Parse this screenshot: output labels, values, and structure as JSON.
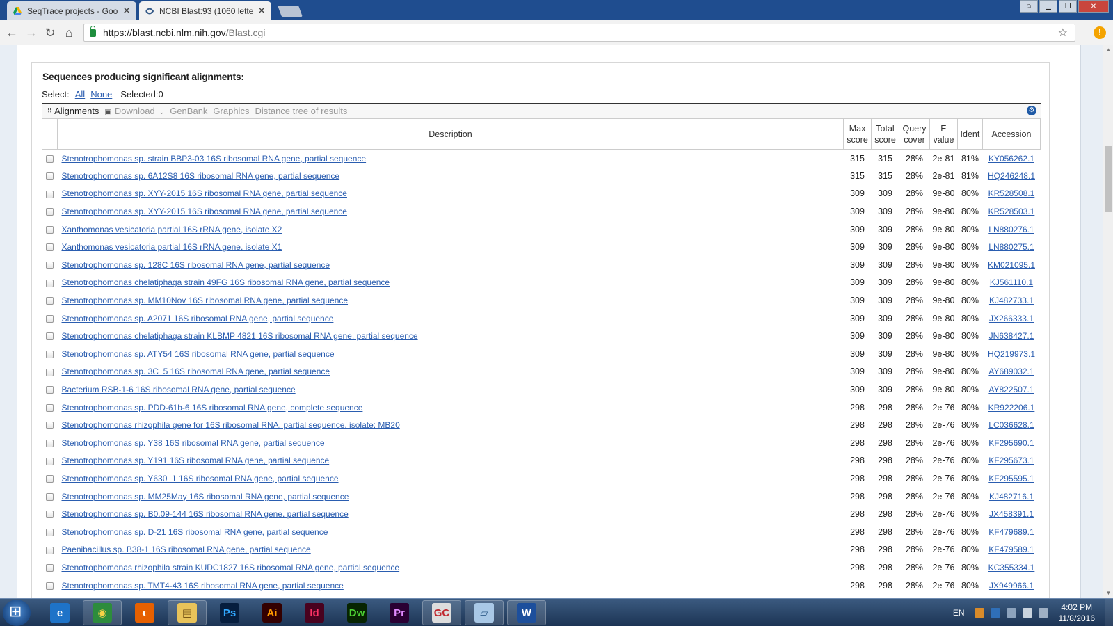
{
  "browser": {
    "tabs": [
      {
        "title": "SeqTrace projects - Goo",
        "active": false
      },
      {
        "title": "NCBI Blast:93 (1060 lette",
        "active": true
      }
    ],
    "url_main": "https://blast.ncbi.nlm.nih.gov",
    "url_path": "/Blast.cgi"
  },
  "results": {
    "section_title": "Sequences producing significant alignments:",
    "select_label": "Select:",
    "select_all": "All",
    "select_none": "None",
    "selected_text": "Selected:0",
    "toolbar": {
      "alignments": "Alignments",
      "download": "Download",
      "genbank": "GenBank",
      "graphics": "Graphics",
      "distance_tree": "Distance tree of results"
    },
    "columns": {
      "description": "Description",
      "max_score": [
        "Max",
        "score"
      ],
      "total_score": [
        "Total",
        "score"
      ],
      "query_cover": [
        "Query",
        "cover"
      ],
      "e_value": [
        "E",
        "value"
      ],
      "ident": "Ident",
      "accession": "Accession"
    },
    "rows": [
      {
        "desc": "Stenotrophomonas sp. strain BBP3-03 16S ribosomal RNA gene, partial sequence",
        "max": "315",
        "total": "315",
        "cover": "28%",
        "e": "2e-81",
        "ident": "81%",
        "acc": "KY056262.1"
      },
      {
        "desc": "Stenotrophomonas sp. 6A12S8 16S ribosomal RNA gene, partial sequence",
        "max": "315",
        "total": "315",
        "cover": "28%",
        "e": "2e-81",
        "ident": "81%",
        "acc": "HQ246248.1"
      },
      {
        "desc": "Stenotrophomonas sp. XYY-2015 16S ribosomal RNA gene, partial sequence",
        "max": "309",
        "total": "309",
        "cover": "28%",
        "e": "9e-80",
        "ident": "80%",
        "acc": "KR528508.1"
      },
      {
        "desc": "Stenotrophomonas sp. XYY-2015 16S ribosomal RNA gene, partial sequence",
        "max": "309",
        "total": "309",
        "cover": "28%",
        "e": "9e-80",
        "ident": "80%",
        "acc": "KR528503.1"
      },
      {
        "desc": "Xanthomonas vesicatoria partial 16S rRNA gene, isolate X2",
        "max": "309",
        "total": "309",
        "cover": "28%",
        "e": "9e-80",
        "ident": "80%",
        "acc": "LN880276.1"
      },
      {
        "desc": "Xanthomonas vesicatoria partial 16S rRNA gene, isolate X1",
        "max": "309",
        "total": "309",
        "cover": "28%",
        "e": "9e-80",
        "ident": "80%",
        "acc": "LN880275.1"
      },
      {
        "desc": "Stenotrophomonas sp. 128C 16S ribosomal RNA gene, partial sequence",
        "max": "309",
        "total": "309",
        "cover": "28%",
        "e": "9e-80",
        "ident": "80%",
        "acc": "KM021095.1"
      },
      {
        "desc": "Stenotrophomonas chelatiphaga strain 49FG 16S ribosomal RNA gene, partial sequence",
        "max": "309",
        "total": "309",
        "cover": "28%",
        "e": "9e-80",
        "ident": "80%",
        "acc": "KJ561110.1"
      },
      {
        "desc": "Stenotrophomonas sp. MM10Nov 16S ribosomal RNA gene, partial sequence",
        "max": "309",
        "total": "309",
        "cover": "28%",
        "e": "9e-80",
        "ident": "80%",
        "acc": "KJ482733.1"
      },
      {
        "desc": "Stenotrophomonas sp. A2071 16S ribosomal RNA gene, partial sequence",
        "max": "309",
        "total": "309",
        "cover": "28%",
        "e": "9e-80",
        "ident": "80%",
        "acc": "JX266333.1"
      },
      {
        "desc": "Stenotrophomonas chelatiphaga strain KLBMP 4821 16S ribosomal RNA gene, partial sequence",
        "max": "309",
        "total": "309",
        "cover": "28%",
        "e": "9e-80",
        "ident": "80%",
        "acc": "JN638427.1"
      },
      {
        "desc": "Stenotrophomonas sp. ATY54 16S ribosomal RNA gene, partial sequence",
        "max": "309",
        "total": "309",
        "cover": "28%",
        "e": "9e-80",
        "ident": "80%",
        "acc": "HQ219973.1"
      },
      {
        "desc": "Stenotrophomonas sp. 3C_5 16S ribosomal RNA gene, partial sequence",
        "max": "309",
        "total": "309",
        "cover": "28%",
        "e": "9e-80",
        "ident": "80%",
        "acc": "AY689032.1"
      },
      {
        "desc": "Bacterium RSB-1-6 16S ribosomal RNA gene, partial sequence",
        "max": "309",
        "total": "309",
        "cover": "28%",
        "e": "9e-80",
        "ident": "80%",
        "acc": "AY822507.1"
      },
      {
        "desc": "Stenotrophomonas sp. PDD-61b-6 16S ribosomal RNA gene, complete sequence",
        "max": "298",
        "total": "298",
        "cover": "28%",
        "e": "2e-76",
        "ident": "80%",
        "acc": "KR922206.1"
      },
      {
        "desc": "Stenotrophomonas rhizophila gene for 16S ribosomal RNA, partial sequence, isolate: MB20",
        "max": "298",
        "total": "298",
        "cover": "28%",
        "e": "2e-76",
        "ident": "80%",
        "acc": "LC036628.1"
      },
      {
        "desc": "Stenotrophomonas sp. Y38 16S ribosomal RNA gene, partial sequence",
        "max": "298",
        "total": "298",
        "cover": "28%",
        "e": "2e-76",
        "ident": "80%",
        "acc": "KF295690.1"
      },
      {
        "desc": "Stenotrophomonas sp. Y191 16S ribosomal RNA gene, partial sequence",
        "max": "298",
        "total": "298",
        "cover": "28%",
        "e": "2e-76",
        "ident": "80%",
        "acc": "KF295673.1"
      },
      {
        "desc": "Stenotrophomonas sp. Y630_1 16S ribosomal RNA gene, partial sequence",
        "max": "298",
        "total": "298",
        "cover": "28%",
        "e": "2e-76",
        "ident": "80%",
        "acc": "KF295595.1"
      },
      {
        "desc": "Stenotrophomonas sp. MM25May 16S ribosomal RNA gene, partial sequence",
        "max": "298",
        "total": "298",
        "cover": "28%",
        "e": "2e-76",
        "ident": "80%",
        "acc": "KJ482716.1"
      },
      {
        "desc": "Stenotrophomonas sp. B0.09-144 16S ribosomal RNA gene, partial sequence",
        "max": "298",
        "total": "298",
        "cover": "28%",
        "e": "2e-76",
        "ident": "80%",
        "acc": "JX458391.1"
      },
      {
        "desc": "Stenotrophomonas sp. D-21 16S ribosomal RNA gene, partial sequence",
        "max": "298",
        "total": "298",
        "cover": "28%",
        "e": "2e-76",
        "ident": "80%",
        "acc": "KF479689.1"
      },
      {
        "desc": "Paenibacillus sp. B38-1 16S ribosomal RNA gene, partial sequence",
        "max": "298",
        "total": "298",
        "cover": "28%",
        "e": "2e-76",
        "ident": "80%",
        "acc": "KF479589.1"
      },
      {
        "desc": "Stenotrophomonas rhizophila strain KUDC1827 16S ribosomal RNA gene, partial sequence",
        "max": "298",
        "total": "298",
        "cover": "28%",
        "e": "2e-76",
        "ident": "80%",
        "acc": "KC355334.1"
      },
      {
        "desc": "Stenotrophomonas sp. TMT4-43 16S ribosomal RNA gene, partial sequence",
        "max": "298",
        "total": "298",
        "cover": "28%",
        "e": "2e-76",
        "ident": "80%",
        "acc": "JX949966.1"
      }
    ]
  },
  "taskbar": {
    "apps": [
      {
        "name": "internet-explorer-icon",
        "glyph": "e",
        "bg": "#1e73c8",
        "fg": "#ffffff",
        "pinned": false
      },
      {
        "name": "chrome-icon",
        "glyph": "◉",
        "bg": "#2d8c3c",
        "fg": "#f7d147",
        "pinned": true
      },
      {
        "name": "firefox-icon",
        "glyph": "◐",
        "bg": "#e66000",
        "fg": "#ffffff",
        "pinned": false
      },
      {
        "name": "file-explorer-icon",
        "glyph": "▤",
        "bg": "#e8c35a",
        "fg": "#6a4a10",
        "pinned": true
      },
      {
        "name": "photoshop-icon",
        "glyph": "Ps",
        "bg": "#061e3e",
        "fg": "#31a8ff",
        "pinned": false
      },
      {
        "name": "illustrator-icon",
        "glyph": "Ai",
        "bg": "#330000",
        "fg": "#ff9a00",
        "pinned": false
      },
      {
        "name": "indesign-icon",
        "glyph": "Id",
        "bg": "#49021f",
        "fg": "#ff3366",
        "pinned": false
      },
      {
        "name": "dreamweaver-icon",
        "glyph": "Dw",
        "bg": "#072401",
        "fg": "#4cd133",
        "pinned": false
      },
      {
        "name": "premiere-icon",
        "glyph": "Pr",
        "bg": "#2a0033",
        "fg": "#e08aff",
        "pinned": false
      },
      {
        "name": "gc-app-icon",
        "glyph": "GC",
        "bg": "#dddddd",
        "fg": "#c0262d",
        "pinned": true
      },
      {
        "name": "notepad-app-icon",
        "glyph": "▱",
        "bg": "#a9c8e6",
        "fg": "#2f5c8a",
        "pinned": true
      },
      {
        "name": "word-icon",
        "glyph": "W",
        "bg": "#1d4f9c",
        "fg": "#ffffff",
        "pinned": true
      }
    ],
    "lang": "EN",
    "time": "4:02 PM",
    "date": "11/8/2016"
  }
}
